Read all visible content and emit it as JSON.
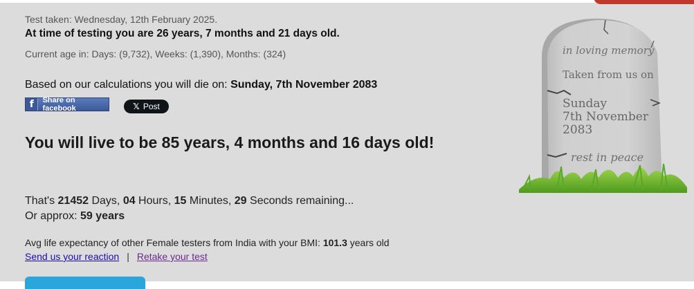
{
  "test_date": "Test taken: Wednesday, 12th February 2025.",
  "age_line": "At time of testing you are 26 years, 7 months and 21 days old.",
  "current_age": "Current age in: Days: (9,732), Weeks: (1,390), Months: (324)",
  "death": {
    "prefix": "Based on our calculations you will die on: ",
    "date": "Sunday, 7th November 2083"
  },
  "share": {
    "facebook_label": "Share on facebook",
    "x_label": "Post"
  },
  "lifespan": "You will live to be 85 years, 4 months and 16 days old!",
  "remaining": {
    "prefix": "That's ",
    "days": "21452",
    "days_label": " Days, ",
    "hours": "04",
    "hours_label": " Hours, ",
    "minutes": "15",
    "minutes_label": " Minutes, ",
    "seconds": "29",
    "seconds_label": " Seconds remaining..."
  },
  "approx": {
    "prefix": "Or approx: ",
    "value": "59 years"
  },
  "avg": {
    "prefix": "Avg life expectancy of other Female testers from India with your BMI: ",
    "value": "101.3",
    "suffix": " years old"
  },
  "links": {
    "reaction": "Send us your reaction",
    "separator": "|",
    "retake": "Retake your test"
  },
  "tombstone": {
    "line1": "in loving memory",
    "line2": "Taken from us on",
    "date_line1": "Sunday",
    "date_line2": "7th November",
    "date_line3": "2083",
    "line_end": "rest in peace"
  },
  "colors": {
    "panel_bg": "#dddcdc",
    "facebook": "#3b5998",
    "x_button": "#0f1419",
    "link": "#1a0dab",
    "visited_link": "#6a2a8e",
    "cta": "#2aa6dc"
  }
}
